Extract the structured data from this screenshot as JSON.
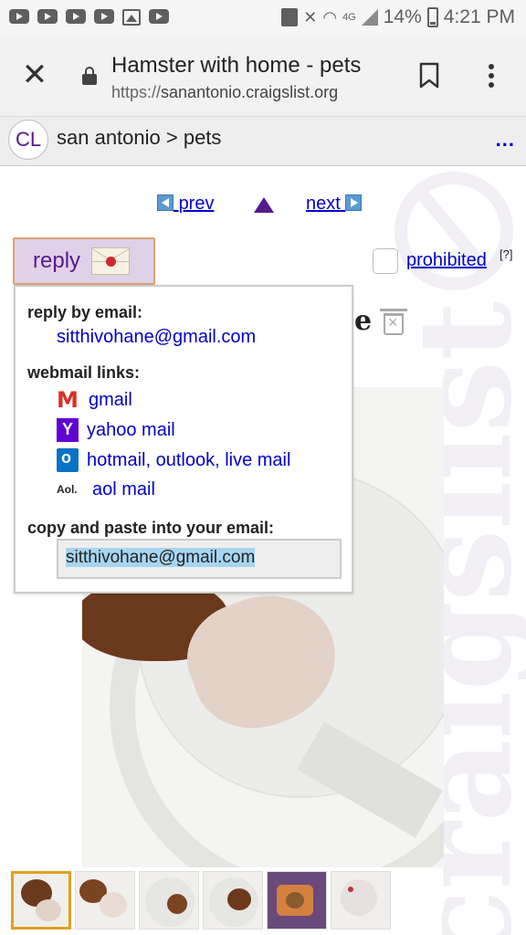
{
  "status_bar": {
    "battery": "14%",
    "time": "4:21 PM",
    "network": "4G",
    "notification_icons": [
      "youtube-icon",
      "youtube-icon",
      "youtube-icon",
      "youtube-icon",
      "gallery-icon",
      "youtube-icon"
    ]
  },
  "browser": {
    "title": "Hamster with home - pets",
    "url_scheme": "https://",
    "url_host": "sanantonio.craigslist.org"
  },
  "craigslist_header": {
    "logo": "CL",
    "breadcrumb": "san antonio > pets",
    "menu": "..."
  },
  "nav": {
    "prev": "prev",
    "next": "next"
  },
  "reply": {
    "button_label": "reply"
  },
  "flag": {
    "label": "prohibited",
    "note": "[?]"
  },
  "posting": {
    "title_fragment": "e"
  },
  "reply_popup": {
    "by_email_heading": "reply by email:",
    "email": "sitthivohane@gmail.com",
    "webmail_heading": "webmail links:",
    "webmail": [
      {
        "label": "gmail",
        "icon": "gmail-icon"
      },
      {
        "label": "yahoo mail",
        "icon": "yahoo-icon"
      },
      {
        "label": "hotmail, outlook, live mail",
        "icon": "outlook-icon"
      },
      {
        "label": "aol mail",
        "icon": "aol-icon"
      }
    ],
    "aol_icon_text": "Aol.",
    "yahoo_icon_text": "Y",
    "copy_heading": "copy and paste into your email:",
    "copy_value": "sitthivohane@gmail.com"
  },
  "colors": {
    "link": "#0000cc",
    "visited": "#551a8b",
    "reply_bg": "#e0d0e8",
    "reply_border": "#e0a070"
  }
}
